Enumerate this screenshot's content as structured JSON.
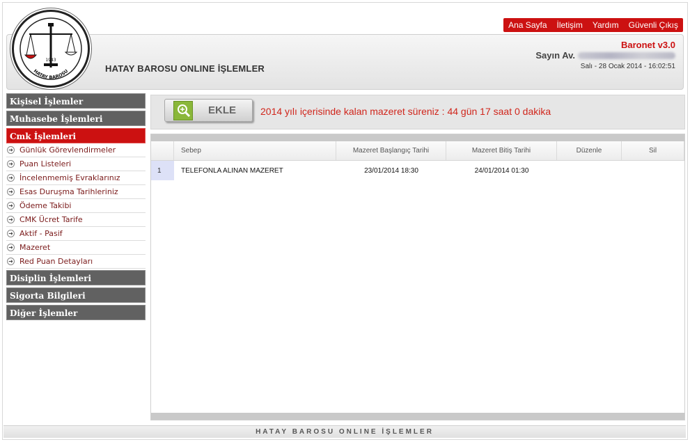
{
  "topnav": {
    "items": [
      "Ana Sayfa",
      "İletişim",
      "Yardım",
      "Güvenli Çıkış"
    ]
  },
  "header": {
    "title": "HATAY BAROSU ONLINE İŞLEMLER",
    "brand": "Baronet v3.0",
    "greeting": "Sayın Av.",
    "datetime": "Salı - 28 Ocak 2014 - 16:02:51",
    "logo_year": "1943",
    "logo_text": "HATAY BAROSU"
  },
  "sidebar": {
    "sections": [
      {
        "label": "Kişisel İşlemler",
        "active": false
      },
      {
        "label": "Muhasebe İşlemleri",
        "active": false
      },
      {
        "label": "Cmk İşlemleri",
        "active": true
      },
      {
        "label": "Disiplin İşlemleri",
        "active": false
      },
      {
        "label": "Sigorta Bilgileri",
        "active": false
      },
      {
        "label": "Diğer İşlemler",
        "active": false
      }
    ],
    "cmk_items": [
      "Günlük Görevlendirmeler",
      "Puan Listeleri",
      "İncelenmemiş Evraklarınız",
      "Esas Duruşma Tarihleriniz",
      "Ödeme Takibi",
      "CMK Ücret Tarife",
      "Aktif - Pasif",
      "Mazeret",
      "Red Puan Detayları"
    ]
  },
  "toolbar": {
    "add_label": "EKLE",
    "notice": "2014 yılı içerisinde kalan mazeret süreniz : 44 gün 17 saat 0 dakika"
  },
  "table": {
    "columns": [
      "",
      "Sebep",
      "Mazeret Başlangıç Tarihi",
      "Mazeret Bitiş Tarihi",
      "Düzenle",
      "Sil"
    ],
    "rows": [
      [
        "1",
        "TELEFONLA ALINAN MAZERET",
        "23/01/2014 18:30",
        "24/01/2014 01:30",
        "",
        ""
      ]
    ]
  },
  "footer": {
    "text": "HATAY BAROSU ONLINE İŞLEMLER"
  },
  "colors": {
    "accent": "#cc1111",
    "sidebar_section": "#616161",
    "notice": "#d0261c"
  }
}
